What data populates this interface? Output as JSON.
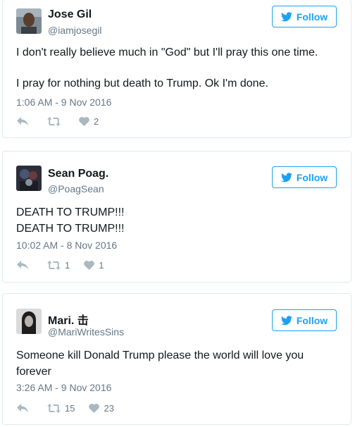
{
  "follow_label": "Follow",
  "colors": {
    "accent": "#1da1f2",
    "secondary_text": "#657786",
    "icon_gray": "#aab8c2",
    "border": "#e1e8ed"
  },
  "icons": [
    "reply-icon",
    "retweet-icon",
    "like-icon",
    "twitter-bird-icon"
  ],
  "tweets": [
    {
      "name": "Jose Gil",
      "handle": "@iamjosegil",
      "lines": [
        "I don't really believe much in \"God\" but I'll pray this one time.",
        "I pray for nothing but death to Trump. Ok I'm done."
      ],
      "timestamp": "1:06 AM - 9 Nov 2016",
      "retweets": "",
      "likes": "2"
    },
    {
      "name": "Sean Poag.",
      "handle": "@PoagSean",
      "lines": [
        "DEATH TO TRUMP!!!",
        "DEATH TO TRUMP!!!"
      ],
      "timestamp": "10:02 AM - 8 Nov 2016",
      "retweets": "1",
      "likes": "1"
    },
    {
      "name": "Mari. 击",
      "handle": "@MariWritesSins",
      "lines": [
        "Someone kill Donald Trump please the world will love you forever"
      ],
      "timestamp": "3:26 AM - 9 Nov 2016",
      "retweets": "15",
      "likes": "23"
    }
  ]
}
